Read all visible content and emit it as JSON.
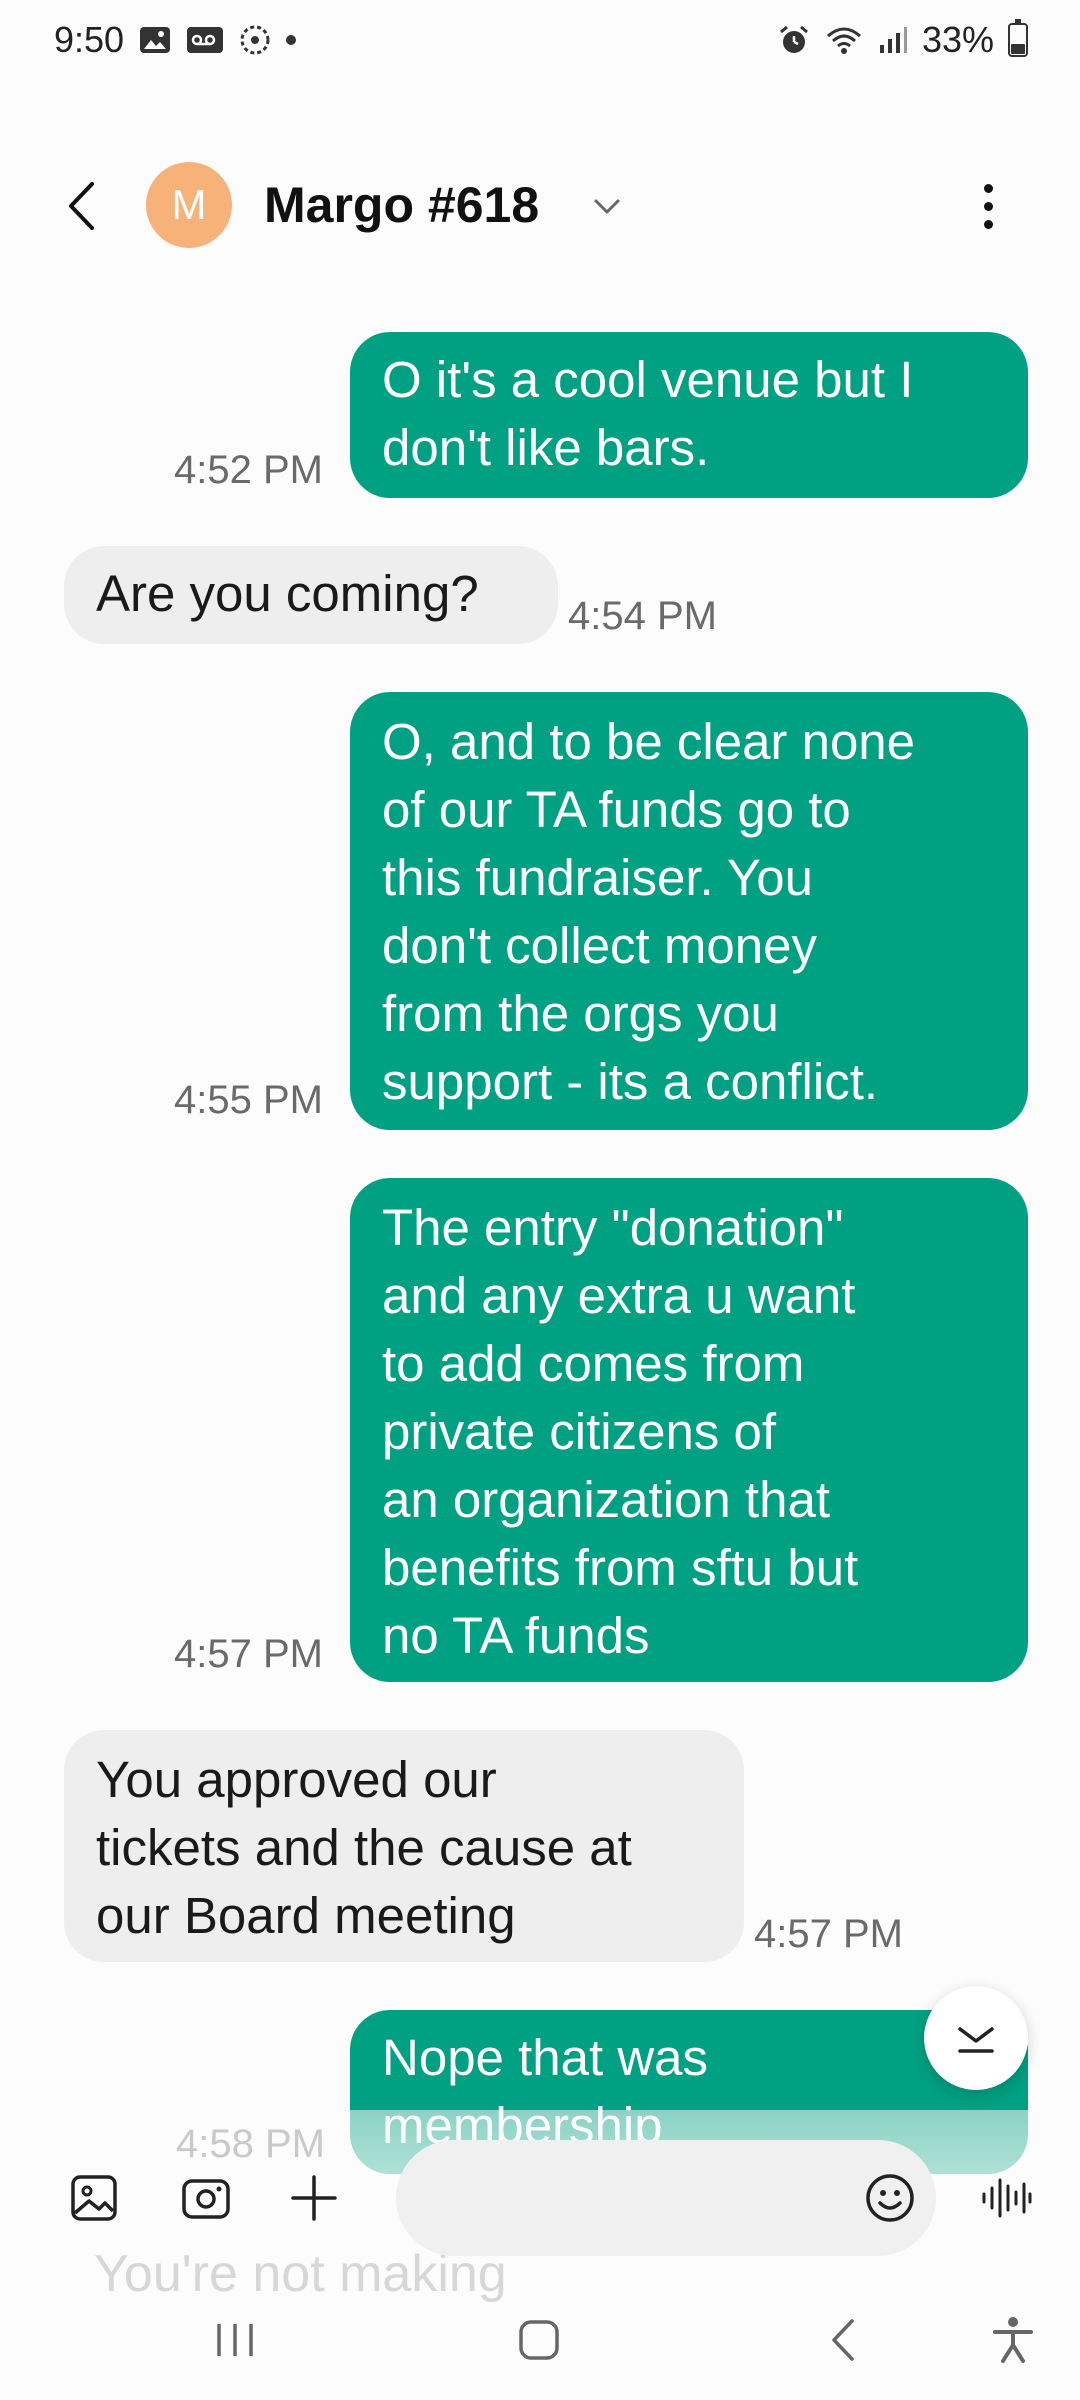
{
  "status_bar": {
    "time": "9:50",
    "battery": "33%",
    "icons": [
      "image-icon",
      "voicemail-icon",
      "sync-icon",
      "dot-icon",
      "alarm-icon",
      "wifi-icon",
      "signal-icon",
      "battery-icon"
    ]
  },
  "header": {
    "avatar_letter": "M",
    "avatar_color": "#f7b27a",
    "contact_name": "Margo #618"
  },
  "colors": {
    "outgoing_bubble": "#00a082",
    "incoming_bubble": "#eeeeee"
  },
  "messages": [
    {
      "direction": "outgoing",
      "lines": [
        "O it's a cool venue but I",
        "don't like bars."
      ],
      "time": "4:52 PM"
    },
    {
      "direction": "incoming",
      "lines": [
        "Are you coming?"
      ],
      "time": "4:54 PM"
    },
    {
      "direction": "outgoing",
      "lines": [
        "O, and to be clear none",
        "of our TA funds go to",
        "this fundraiser. You",
        "don't collect money",
        "from the orgs you",
        "support - its a conflict."
      ],
      "time": "4:55 PM"
    },
    {
      "direction": "outgoing",
      "lines": [
        "The entry \"donation\"",
        "and any extra u want",
        "to add comes from",
        "private citizens of",
        "an organization that",
        "benefits from sftu but",
        "no TA funds"
      ],
      "time": "4:57 PM"
    },
    {
      "direction": "incoming",
      "lines": [
        "You approved our",
        "tickets and the cause at",
        "our Board meeting"
      ],
      "time": "4:57 PM"
    },
    {
      "direction": "outgoing",
      "lines": [
        "Nope that was",
        "membership"
      ],
      "time": "4:58 PM"
    }
  ],
  "partial_incoming": "You're not making",
  "composer": {
    "placeholder": ""
  }
}
